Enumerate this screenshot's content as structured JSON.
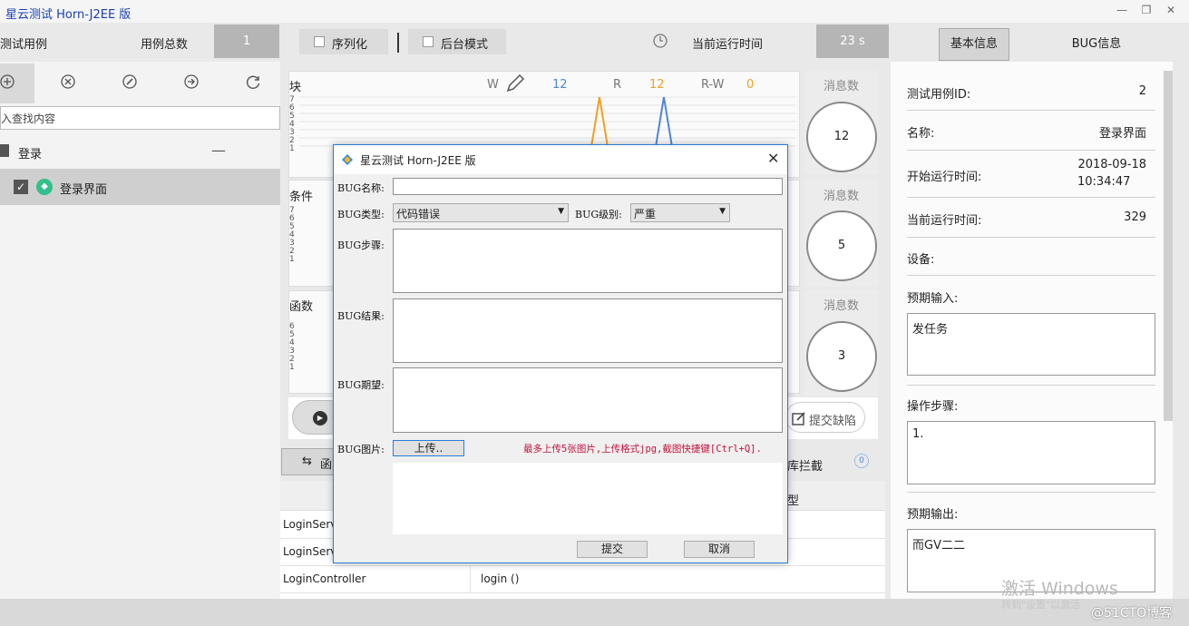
{
  "window": {
    "title": "星云测试 Horn-J2EE 版",
    "controls": [
      "—",
      "❐",
      "✕"
    ]
  },
  "toolbar": {
    "test_case_label": "测试用例",
    "case_count_label": "用例总数",
    "case_count_value": "1",
    "serialize_label": "序列化",
    "background_mode_label": "后台模式",
    "run_time_label": "当前运行时间",
    "run_time_value": "23 s"
  },
  "right_tabs": {
    "basic_info": "基本信息",
    "bug_info": "BUG信息"
  },
  "left": {
    "search_placeholder": "入查找内容",
    "group_label": "登录",
    "collapse_symbol": "—",
    "case_item": "登录界面"
  },
  "charts": [
    {
      "title": "块",
      "stats": {
        "w_label": "W",
        "w_value": "12",
        "r_label": "R",
        "r_value": "12",
        "rw_label": "R-W",
        "rw_value": "0"
      },
      "ticks": [
        "7",
        "6",
        "5",
        "4",
        "3",
        "2",
        "1"
      ],
      "msg_label": "消息数",
      "msg_value": "12"
    },
    {
      "title": "条件",
      "ticks": [
        "7",
        "6",
        "5",
        "4",
        "3",
        "2",
        "1"
      ],
      "msg_label": "消息数",
      "msg_value": "5"
    },
    {
      "title": "函数",
      "ticks": [
        "6",
        "5",
        "4",
        "3",
        "2",
        "1"
      ],
      "msg_label": "消息数",
      "msg_value": "3"
    }
  ],
  "actions": {
    "submit_defect": "提交缺陷",
    "partial_tab": "函",
    "intercept_tab": "库拦截",
    "intercept_count": "0",
    "type_header": "型"
  },
  "table": {
    "rows": [
      [
        "LoginServ",
        ""
      ],
      [
        "LoginServ",
        ""
      ],
      [
        "LoginController",
        "login ()"
      ]
    ]
  },
  "info": {
    "case_id_label": "测试用例ID:",
    "case_id_value": "2",
    "name_label": "名称:",
    "name_value": "登录界面",
    "start_time_label": "开始运行时间:",
    "start_date": "2018-09-18",
    "start_time": "10:34:47",
    "current_time_label": "当前运行时间:",
    "current_time_value": "329",
    "device_label": "设备:",
    "expected_input_label": "预期输入:",
    "expected_input_value": "发任务",
    "steps_label": "操作步骤:",
    "steps_value": "1.",
    "expected_output_label": "预期输出:",
    "expected_output_value": "而GV二二"
  },
  "dialog": {
    "title": "星云测试 Horn-J2EE 版",
    "bug_name_label": "BUG名称:",
    "bug_type_label": "BUG类型:",
    "bug_type_value": "代码错误",
    "bug_level_label": "BUG级别:",
    "bug_level_value": "严重",
    "bug_steps_label": "BUG步骤:",
    "bug_result_label": "BUG结果:",
    "bug_expect_label": "BUG期望:",
    "bug_image_label": "BUG图片:",
    "upload_button": "上传..",
    "upload_hint": "最多上传5张图片,上传格式jpg,截图快捷键[Ctrl+Q].",
    "submit_button": "提交",
    "cancel_button": "取消",
    "hint_color": "#c0133a"
  },
  "watermark": {
    "activate": "激活 Windows",
    "sub": "转到\"设置\"以激活",
    "site": "@51CTO博客"
  },
  "colors": {
    "series_w": "#4f86d9",
    "series_r": "#f0a020",
    "accent_blue": "#2b7bd8"
  }
}
